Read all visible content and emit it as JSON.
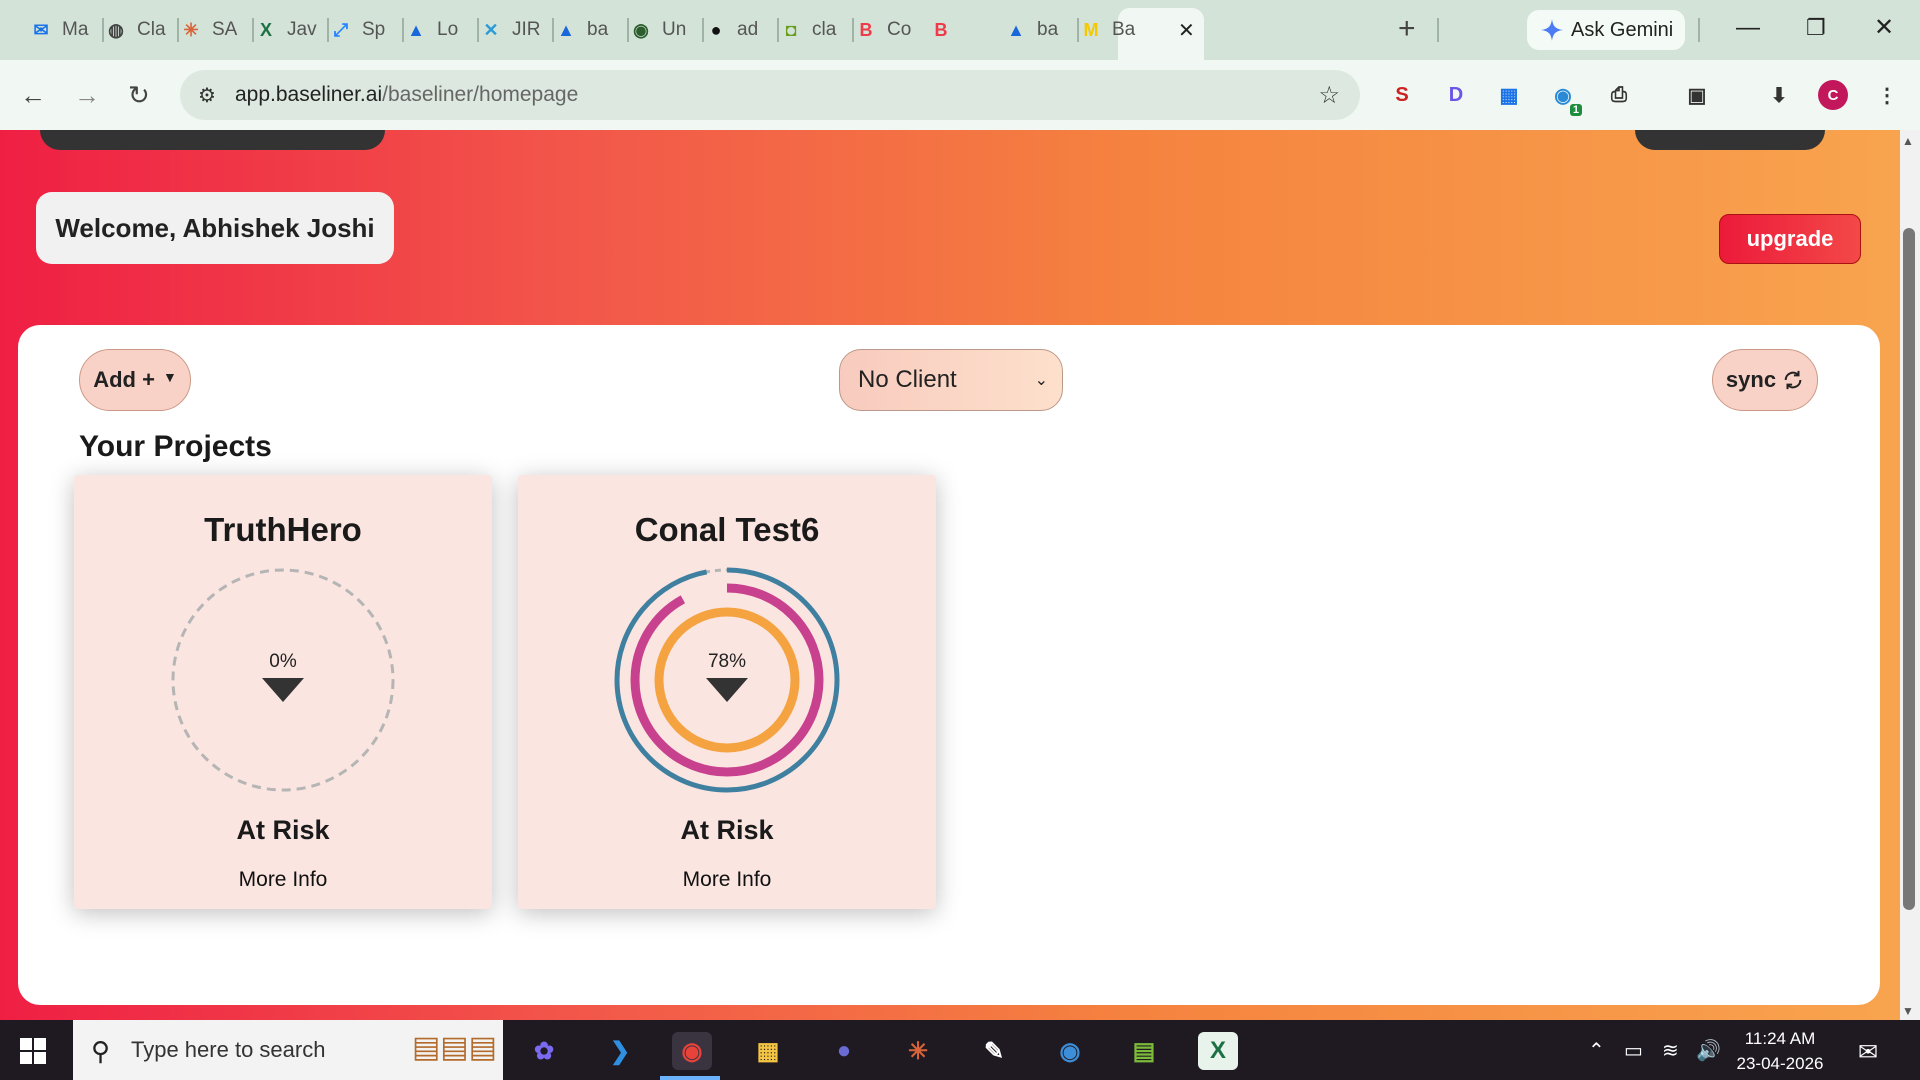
{
  "browser": {
    "tabs": [
      {
        "label": "Ma",
        "icon": "outlook-icon",
        "glyph": "✉",
        "color": "#1a73e8"
      },
      {
        "label": "Cla",
        "icon": "globe-icon",
        "glyph": "◍",
        "color": "#444"
      },
      {
        "label": "SA",
        "icon": "claude-icon",
        "glyph": "✳",
        "color": "#d9643a"
      },
      {
        "label": "Jav",
        "icon": "excel-icon",
        "glyph": "X",
        "color": "#1d7044"
      },
      {
        "label": "Sp",
        "icon": "jira-icon",
        "glyph": "⤢",
        "color": "#2684ff"
      },
      {
        "label": "Lo",
        "icon": "atlassian-icon",
        "glyph": "▲",
        "color": "#1868db"
      },
      {
        "label": "JIR",
        "icon": "jira-sprint-icon",
        "glyph": "✕",
        "color": "#2a9bd6"
      },
      {
        "label": "ba",
        "icon": "atlassian-icon",
        "glyph": "▲",
        "color": "#1868db"
      },
      {
        "label": "Un",
        "icon": "earth-icon",
        "glyph": "◉",
        "color": "#2c5d2c"
      },
      {
        "label": "ad",
        "icon": "github-icon",
        "glyph": "●",
        "color": "#111"
      },
      {
        "label": "cla",
        "icon": "green-box-icon",
        "glyph": "◘",
        "color": "#6a9e1f"
      },
      {
        "label": "Co",
        "icon": "baseliner-icon",
        "glyph": "B",
        "color": "#ef3a4a"
      },
      {
        "label": "",
        "icon": "baseliner-icon",
        "glyph": "B",
        "color": "#ef3a4a"
      },
      {
        "label": "ba",
        "icon": "atlassian-icon",
        "glyph": "▲",
        "color": "#1868db"
      },
      {
        "label": "Ba",
        "icon": "miro-icon",
        "glyph": "M",
        "color": "#f5c800"
      }
    ],
    "close_glyph": "✕",
    "new_tab_glyph": "+",
    "gemini_label": "Ask Gemini",
    "url_host": "app.baseliner.ai",
    "url_path": "/baseliner/homepage",
    "profile_initial": "C",
    "extension_badge": "1"
  },
  "app": {
    "welcome": "Welcome, Abhishek Joshi",
    "upgrade": "upgrade",
    "add_button": "Add +",
    "client_select": "No Client",
    "sync_button": "sync",
    "section_title": "Your Projects",
    "projects": [
      {
        "name": "TruthHero",
        "percent": "0%",
        "status": "At Risk",
        "more": "More Info",
        "progress": {
          "outer": 0,
          "middle": 0,
          "inner": 0
        }
      },
      {
        "name": "Conal Test6",
        "percent": "78%",
        "status": "At Risk",
        "more": "More Info",
        "progress": {
          "outer": 0.97,
          "middle": 0.92,
          "inner": 1.0
        }
      }
    ],
    "colors": {
      "ring_outer": "#3f7fa0",
      "ring_middle": "#c8418e",
      "ring_inner": "#f4a340",
      "ring_empty": "#b5b5b5"
    }
  },
  "taskbar": {
    "search_placeholder": "Type here to search",
    "time": "11:24 AM",
    "date": "23-04-2026"
  }
}
